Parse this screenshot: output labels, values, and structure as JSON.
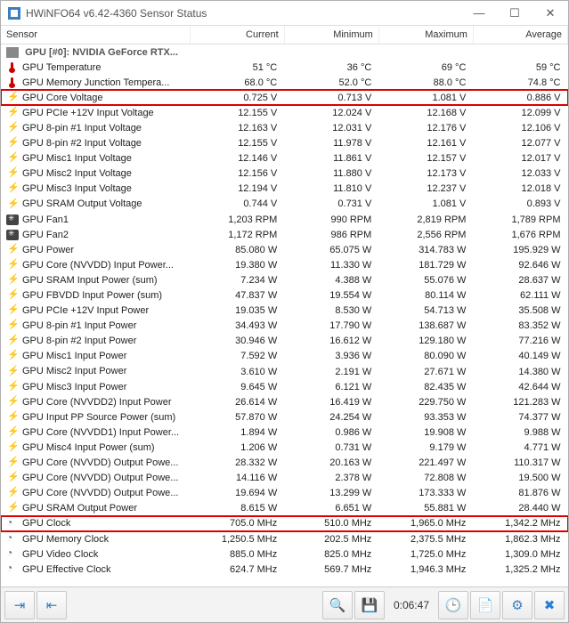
{
  "window": {
    "title": "HWiNFO64 v6.42-4360 Sensor Status"
  },
  "columns": {
    "name": "Sensor",
    "current": "Current",
    "minimum": "Minimum",
    "maximum": "Maximum",
    "average": "Average"
  },
  "group": {
    "label": "GPU [#0]: NVIDIA GeForce RTX..."
  },
  "rows": [
    {
      "icon": "temp",
      "name": "GPU Temperature",
      "cur": "51 °C",
      "min": "36 °C",
      "max": "69 °C",
      "avg": "59 °C"
    },
    {
      "icon": "temp",
      "name": "GPU Memory Junction Tempera...",
      "cur": "68.0 °C",
      "min": "52.0 °C",
      "max": "88.0 °C",
      "avg": "74.8 °C"
    },
    {
      "icon": "volt",
      "name": "GPU Core Voltage",
      "cur": "0.725 V",
      "min": "0.713 V",
      "max": "1.081 V",
      "avg": "0.886 V",
      "hl": true
    },
    {
      "icon": "volt",
      "name": "GPU PCIe +12V Input Voltage",
      "cur": "12.155 V",
      "min": "12.024 V",
      "max": "12.168 V",
      "avg": "12.099 V"
    },
    {
      "icon": "volt",
      "name": "GPU 8-pin #1 Input Voltage",
      "cur": "12.163 V",
      "min": "12.031 V",
      "max": "12.176 V",
      "avg": "12.106 V"
    },
    {
      "icon": "volt",
      "name": "GPU 8-pin #2 Input Voltage",
      "cur": "12.155 V",
      "min": "11.978 V",
      "max": "12.161 V",
      "avg": "12.077 V"
    },
    {
      "icon": "volt",
      "name": "GPU Misc1 Input Voltage",
      "cur": "12.146 V",
      "min": "11.861 V",
      "max": "12.157 V",
      "avg": "12.017 V"
    },
    {
      "icon": "volt",
      "name": "GPU Misc2 Input Voltage",
      "cur": "12.156 V",
      "min": "11.880 V",
      "max": "12.173 V",
      "avg": "12.033 V"
    },
    {
      "icon": "volt",
      "name": "GPU Misc3 Input Voltage",
      "cur": "12.194 V",
      "min": "11.810 V",
      "max": "12.237 V",
      "avg": "12.018 V"
    },
    {
      "icon": "volt",
      "name": "GPU SRAM Output Voltage",
      "cur": "0.744 V",
      "min": "0.731 V",
      "max": "1.081 V",
      "avg": "0.893 V"
    },
    {
      "icon": "fan",
      "name": "GPU Fan1",
      "cur": "1,203 RPM",
      "min": "990 RPM",
      "max": "2,819 RPM",
      "avg": "1,789 RPM"
    },
    {
      "icon": "fan",
      "name": "GPU Fan2",
      "cur": "1,172 RPM",
      "min": "986 RPM",
      "max": "2,556 RPM",
      "avg": "1,676 RPM"
    },
    {
      "icon": "power",
      "name": "GPU Power",
      "cur": "85.080 W",
      "min": "65.075 W",
      "max": "314.783 W",
      "avg": "195.929 W"
    },
    {
      "icon": "power",
      "name": "GPU Core (NVVDD) Input Power...",
      "cur": "19.380 W",
      "min": "11.330 W",
      "max": "181.729 W",
      "avg": "92.646 W"
    },
    {
      "icon": "power",
      "name": "GPU SRAM Input Power (sum)",
      "cur": "7.234 W",
      "min": "4.388 W",
      "max": "55.076 W",
      "avg": "28.637 W"
    },
    {
      "icon": "power",
      "name": "GPU FBVDD Input Power (sum)",
      "cur": "47.837 W",
      "min": "19.554 W",
      "max": "80.114 W",
      "avg": "62.111 W"
    },
    {
      "icon": "power",
      "name": "GPU PCIe +12V Input Power",
      "cur": "19.035 W",
      "min": "8.530 W",
      "max": "54.713 W",
      "avg": "35.508 W"
    },
    {
      "icon": "power",
      "name": "GPU 8-pin #1 Input Power",
      "cur": "34.493 W",
      "min": "17.790 W",
      "max": "138.687 W",
      "avg": "83.352 W"
    },
    {
      "icon": "power",
      "name": "GPU 8-pin #2 Input Power",
      "cur": "30.946 W",
      "min": "16.612 W",
      "max": "129.180 W",
      "avg": "77.216 W"
    },
    {
      "icon": "power",
      "name": "GPU Misc1 Input Power",
      "cur": "7.592 W",
      "min": "3.936 W",
      "max": "80.090 W",
      "avg": "40.149 W"
    },
    {
      "icon": "power",
      "name": "GPU Misc2 Input Power",
      "cur": "3.610 W",
      "min": "2.191 W",
      "max": "27.671 W",
      "avg": "14.380 W"
    },
    {
      "icon": "power",
      "name": "GPU Misc3 Input Power",
      "cur": "9.645 W",
      "min": "6.121 W",
      "max": "82.435 W",
      "avg": "42.644 W"
    },
    {
      "icon": "power",
      "name": "GPU Core (NVVDD2) Input Power",
      "cur": "26.614 W",
      "min": "16.419 W",
      "max": "229.750 W",
      "avg": "121.283 W"
    },
    {
      "icon": "power",
      "name": "GPU Input PP Source Power (sum)",
      "cur": "57.870 W",
      "min": "24.254 W",
      "max": "93.353 W",
      "avg": "74.377 W"
    },
    {
      "icon": "power",
      "name": "GPU Core (NVVDD1) Input Power...",
      "cur": "1.894 W",
      "min": "0.986 W",
      "max": "19.908 W",
      "avg": "9.988 W"
    },
    {
      "icon": "power",
      "name": "GPU Misc4 Input Power (sum)",
      "cur": "1.206 W",
      "min": "0.731 W",
      "max": "9.179 W",
      "avg": "4.771 W"
    },
    {
      "icon": "power",
      "name": "GPU Core (NVVDD) Output Powe...",
      "cur": "28.332 W",
      "min": "20.163 W",
      "max": "221.497 W",
      "avg": "110.317 W"
    },
    {
      "icon": "power",
      "name": "GPU Core (NVVDD) Output Powe...",
      "cur": "14.116 W",
      "min": "2.378 W",
      "max": "72.808 W",
      "avg": "19.500 W"
    },
    {
      "icon": "power",
      "name": "GPU Core (NVVDD) Output Powe...",
      "cur": "19.694 W",
      "min": "13.299 W",
      "max": "173.333 W",
      "avg": "81.876 W"
    },
    {
      "icon": "power",
      "name": "GPU SRAM Output Power",
      "cur": "8.615 W",
      "min": "6.651 W",
      "max": "55.881 W",
      "avg": "28.440 W"
    },
    {
      "icon": "clock",
      "name": "GPU Clock",
      "cur": "705.0 MHz",
      "min": "510.0 MHz",
      "max": "1,965.0 MHz",
      "avg": "1,342.2 MHz",
      "hl": true
    },
    {
      "icon": "clock",
      "name": "GPU Memory Clock",
      "cur": "1,250.5 MHz",
      "min": "202.5 MHz",
      "max": "2,375.5 MHz",
      "avg": "1,862.3 MHz"
    },
    {
      "icon": "clock",
      "name": "GPU Video Clock",
      "cur": "885.0 MHz",
      "min": "825.0 MHz",
      "max": "1,725.0 MHz",
      "avg": "1,309.0 MHz"
    },
    {
      "icon": "clock",
      "name": "GPU Effective Clock",
      "cur": "624.7 MHz",
      "min": "569.7 MHz",
      "max": "1,946.3 MHz",
      "avg": "1,325.2 MHz"
    }
  ],
  "toolbar": {
    "elapsed": "0:06:47"
  }
}
